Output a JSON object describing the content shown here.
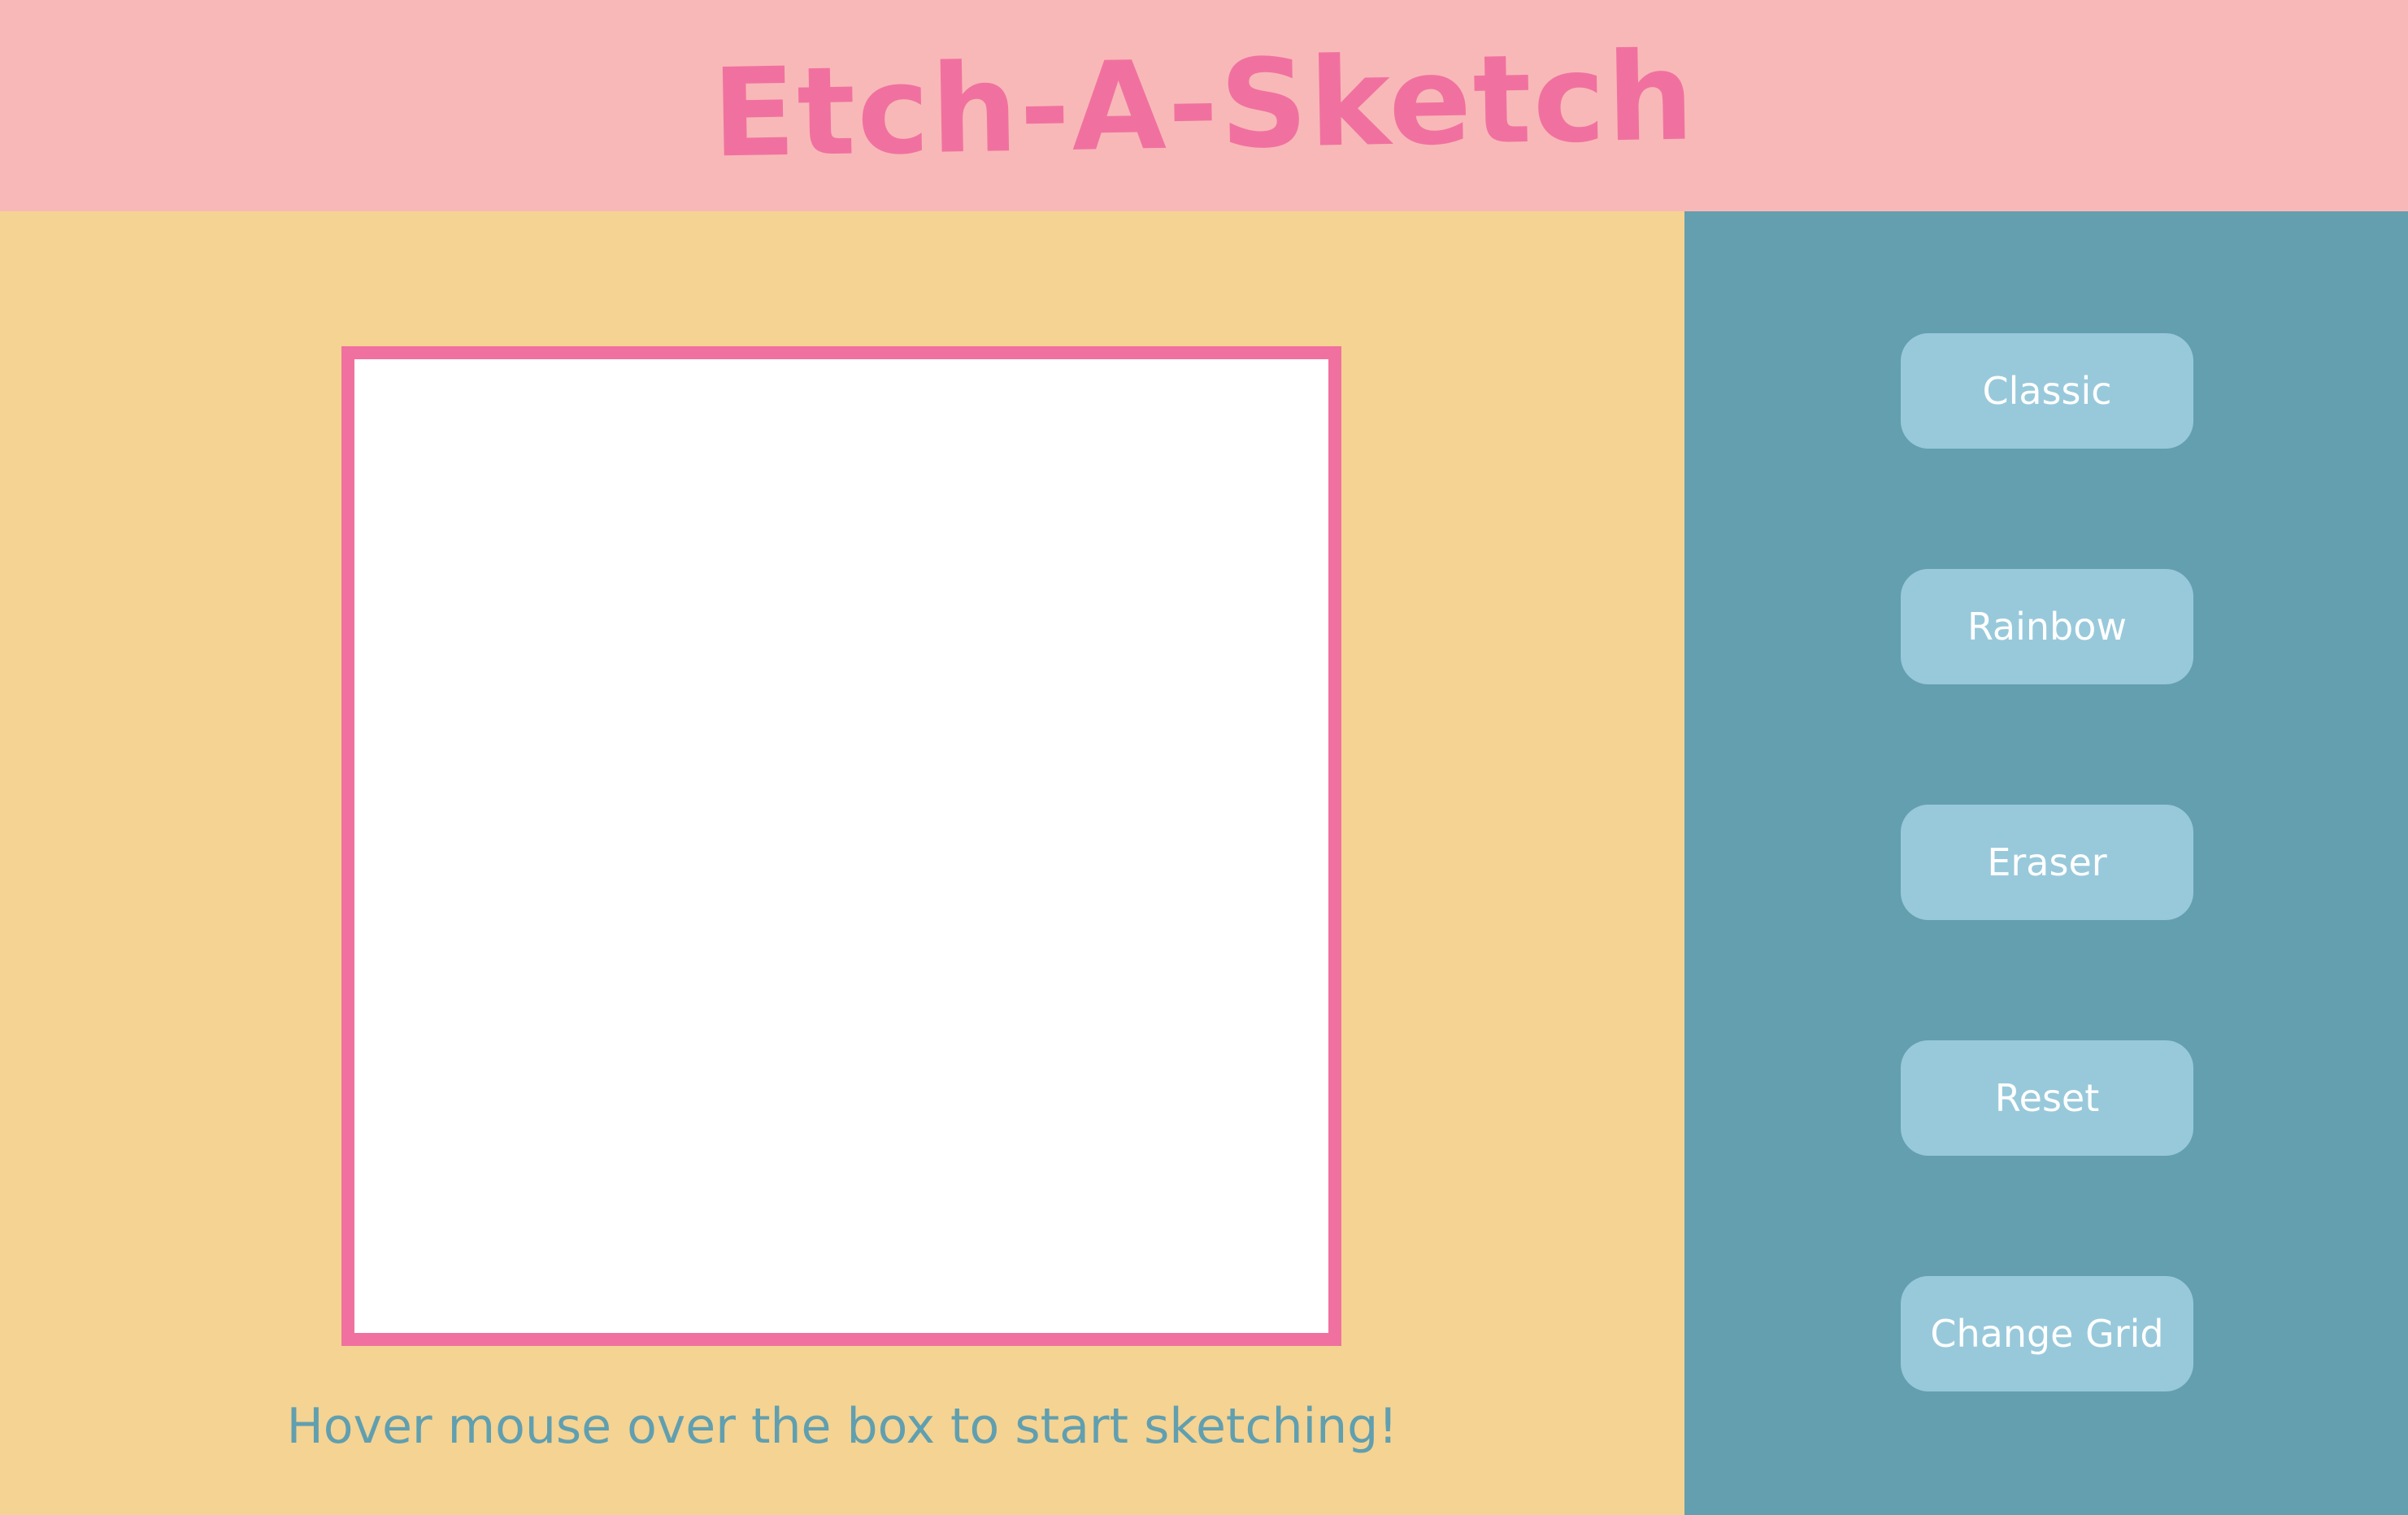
{
  "header": {
    "title": "Etch-A-Sketch"
  },
  "main": {
    "hint": "Hover mouse over the box to start sketching!"
  },
  "sidebar": {
    "buttons": [
      {
        "label": "Classic"
      },
      {
        "label": "Rainbow"
      },
      {
        "label": "Eraser"
      },
      {
        "label": "Reset"
      },
      {
        "label": "Change Grid"
      }
    ]
  },
  "colors": {
    "header_bg": "#f8b8b8",
    "title": "#f0719f",
    "main_bg": "#f5d392",
    "canvas_border": "#f0719f",
    "canvas_bg": "#ffffff",
    "sidebar_bg": "#639faf",
    "button_bg": "#98c9db",
    "button_text": "#ffffff",
    "hint_text": "#609fb0"
  }
}
